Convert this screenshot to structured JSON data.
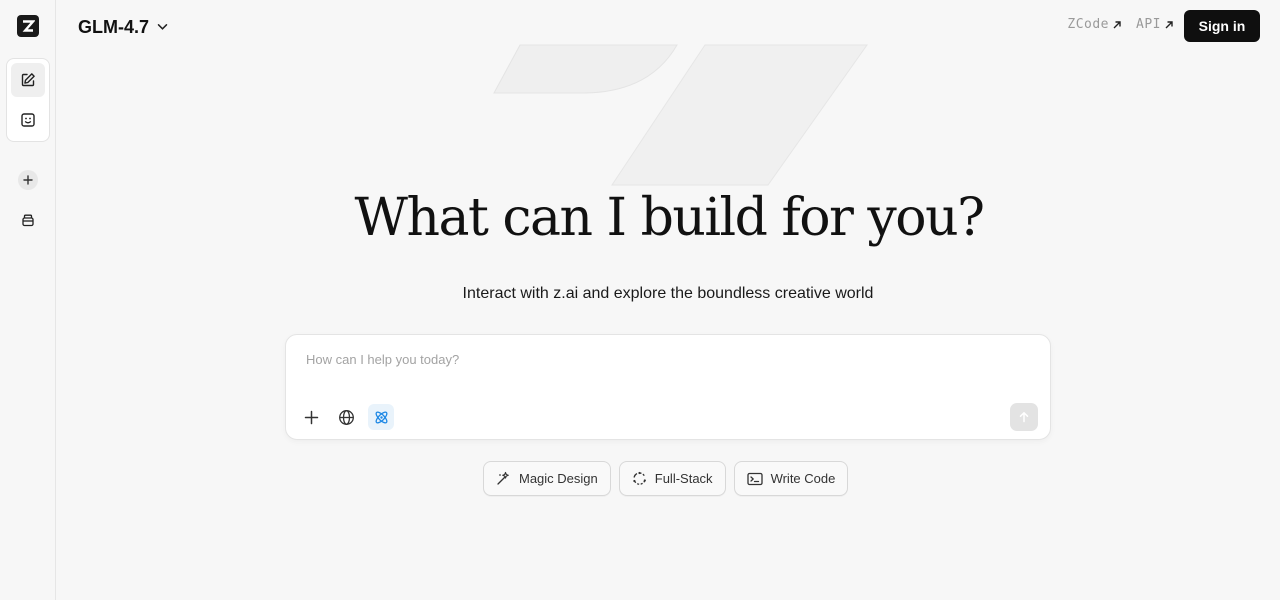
{
  "header": {
    "model": "GLM-4.7",
    "links": [
      {
        "label": "ZCode"
      },
      {
        "label": "API"
      }
    ],
    "signin_label": "Sign in"
  },
  "sidebar": {
    "logo": "Z",
    "icons": [
      "edit-icon",
      "agent-face-icon",
      "plus-icon",
      "archive-icon"
    ]
  },
  "hero": {
    "title": "What can I build for you?",
    "subtitle": "Interact with z.ai and explore the boundless creative world"
  },
  "composer": {
    "placeholder": "How can I help you today?",
    "tools": [
      "plus-icon",
      "globe-icon",
      "atom-icon"
    ],
    "active_tool": "atom-icon"
  },
  "chips": [
    {
      "label": "Magic Design",
      "icon": "magic-wand-icon"
    },
    {
      "label": "Full-Stack",
      "icon": "cycle-icon"
    },
    {
      "label": "Write Code",
      "icon": "terminal-icon"
    }
  ],
  "colors": {
    "background": "#f7f7f7",
    "accent_active": "#1e88e5",
    "signin_bg": "#0f0f0f"
  }
}
